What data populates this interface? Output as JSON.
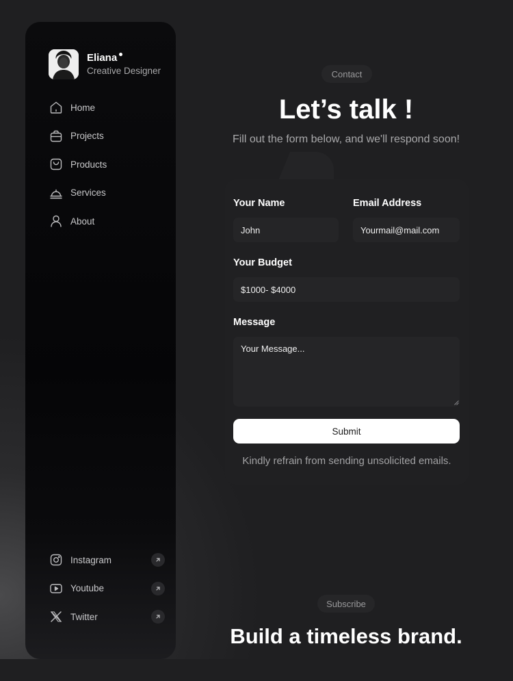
{
  "profile": {
    "name": "Eliana",
    "role": "Creative Designer"
  },
  "nav": {
    "items": [
      {
        "label": "Home",
        "icon": "home-icon"
      },
      {
        "label": "Projects",
        "icon": "briefcase-icon"
      },
      {
        "label": "Products",
        "icon": "bag-icon"
      },
      {
        "label": "Services",
        "icon": "service-bell-icon"
      },
      {
        "label": "About",
        "icon": "user-icon"
      }
    ]
  },
  "social": {
    "items": [
      {
        "label": "Instagram",
        "icon": "instagram-icon"
      },
      {
        "label": "Youtube",
        "icon": "youtube-icon"
      },
      {
        "label": "Twitter",
        "icon": "x-icon"
      }
    ]
  },
  "contact": {
    "pill": "Contact",
    "title": "Let’s talk !",
    "subtitle": "Fill out the form below, and we'll respond soon!"
  },
  "form": {
    "name_label": "Your Name",
    "name_value": "John",
    "email_label": "Email Address",
    "email_value": "Yourmail@mail.com",
    "budget_label": "Your Budget",
    "budget_value": "$1000- $4000",
    "message_label": "Message",
    "message_placeholder": "Your Message...",
    "submit_label": "Submit",
    "disclaimer": "Kindly refrain from sending unsolicited emails."
  },
  "subscribe": {
    "pill": "Subscribe",
    "title": "Build a timeless brand."
  },
  "colors": {
    "background": "#1f1f21",
    "sidebar": "#050507",
    "accent": "#ffffff",
    "muted_text": "#a9a9ab"
  }
}
